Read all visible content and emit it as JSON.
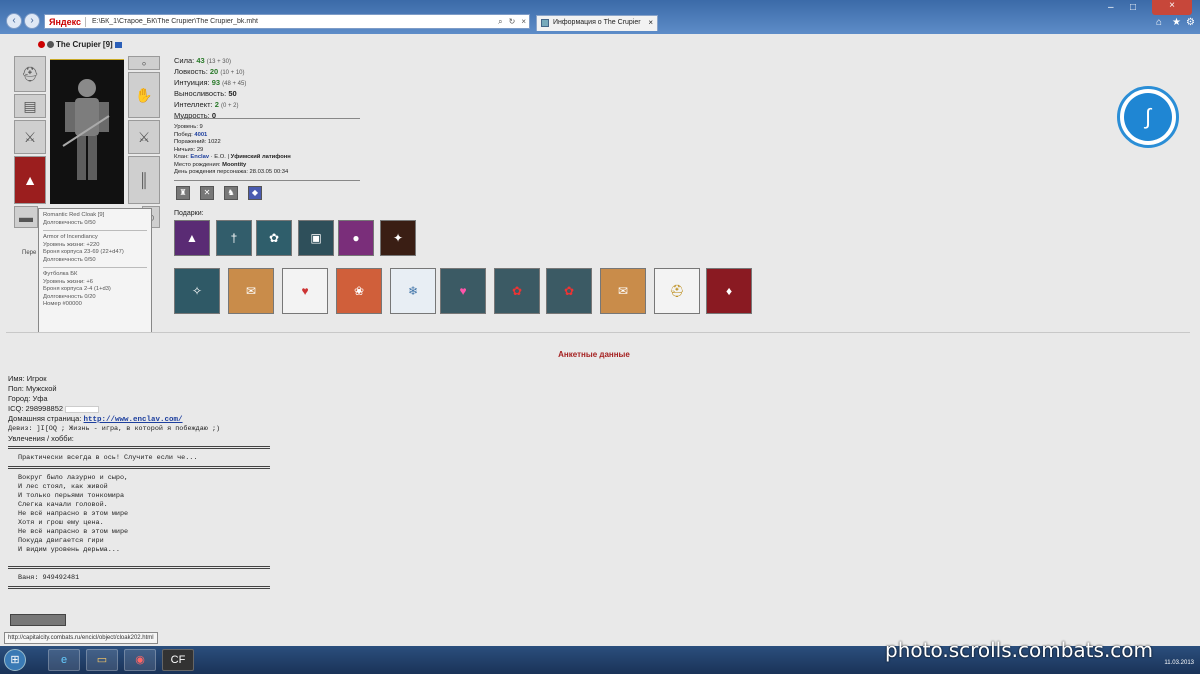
{
  "browser": {
    "yandex_label": "Яндекс",
    "address_url": "E:\\БК_1\\Старое_БК\\The Crupier\\The Crupier_bk.mht",
    "address_icons": [
      "search-icon",
      "refresh-icon",
      "close-icon"
    ],
    "tabs": [
      {
        "label": "Информация о The Crupier"
      }
    ]
  },
  "character": {
    "name": "The Crupier",
    "level": "[9]",
    "hp_fraction": 1.0,
    "stats": [
      {
        "label": "Сила:",
        "value": "43",
        "extra": "(13 + 30)"
      },
      {
        "label": "Ловкость:",
        "value": "20",
        "extra": "(10 + 10)"
      },
      {
        "label": "Интуиция:",
        "value": "93",
        "extra": "(48 + 45)"
      },
      {
        "label": "Выносливость:",
        "value": "50",
        "extra": ""
      },
      {
        "label": "Интеллект:",
        "value": "2",
        "extra": "(0 + 2)"
      },
      {
        "label": "Мудрость:",
        "value": "0",
        "extra": ""
      }
    ],
    "info": {
      "level_line": "Уровень: 9",
      "wins_label": "Побед:",
      "wins": "4001",
      "losses": "Поражений: 1022",
      "draws": "Ничьих: 29",
      "clan_label": "Клан:",
      "clan": "Enclav",
      "clan_suffix": " · E.O. |",
      "clan_rank": "Уфимский латифонн",
      "birthplace_label": "Место рождения:",
      "birthplace": "Moontity",
      "birthday": "День рождения персонажа: 28.03.05 00:34"
    },
    "gifts_label": "Подарки:"
  },
  "tooltip": {
    "items": [
      {
        "name": "Romantic Red Cloak [9]",
        "lines": [
          "Долговечность 0/50"
        ]
      },
      {
        "name": "Armor of Incendiancy",
        "lines": [
          "Уровень жизни: +220",
          "Броня корпуса 23-69 (22+d47)",
          "Долговечность 0/50"
        ]
      },
      {
        "name": "Футболка БК",
        "lines": [
          "Уровень жизни: +6",
          "Броня корпуса 2-4 (1+d3)",
          "Долговечность 0/20",
          "Номер #00000"
        ]
      }
    ]
  },
  "side_label": "Пере",
  "profile": {
    "section_title": "Анкетные данные",
    "name_line": "Имя: Игрок",
    "gender_line": "Пол: Мужской",
    "city_line": "Город: Уфа",
    "icq_line": "ICQ: 298998852",
    "homepage_label": "Домашняя страница:",
    "homepage": "http://www.enclav.com/",
    "motto_line": "Девиз: ]I[OQ ; Жизнь - игра, в которой я побеждаю ;)",
    "hobby_line": "Увлечения / хобби:",
    "hobby_intro": "Практически всегда в ось! Случите если че...",
    "poem": [
      "Вокруг было лазурно и сыро,",
      "И лес стоял, как живой",
      "И только перьями тонкомира",
      "Слегка качали головой.",
      "Не всё напрасно в этом мире",
      "Хотя и грош ему цена.",
      "Не всё напрасно в этом мире",
      "Покуда двигается гири",
      "И видим уровень дерьма..."
    ],
    "wallet_line": "Ваня: 949492481"
  },
  "status_bar": "http://capitalcity.combats.ru/encicl/object/cloak202.html",
  "watermark": "photo.scrolls.combats.com",
  "clock": "11.03.2013",
  "colors": {
    "accent_red": "#a52020",
    "link_blue": "#1d3f9e",
    "stat_green": "#2a7a2a"
  }
}
